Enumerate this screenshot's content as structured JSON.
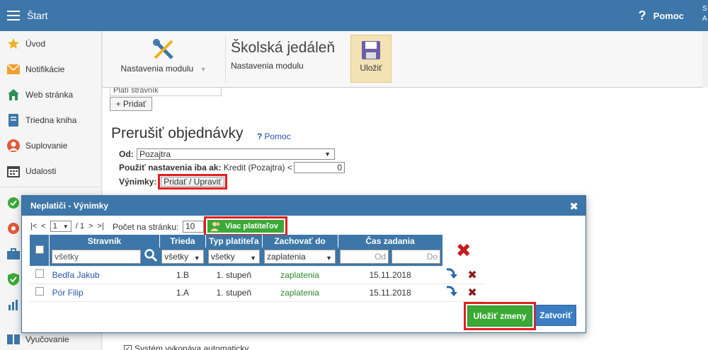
{
  "topbar": {
    "title": "Štart",
    "help_label": "Pomoc",
    "user_initial": "S",
    "user_initial2": "A"
  },
  "sidebar": {
    "items": [
      {
        "label": "Úvod",
        "icon": "star-icon"
      },
      {
        "label": "Notifikácie",
        "icon": "envelope-icon"
      },
      {
        "label": "Web stránka",
        "icon": "home-icon"
      },
      {
        "label": "Triedna kniha",
        "icon": "book-icon"
      },
      {
        "label": "Suplovanie",
        "icon": "person-icon"
      },
      {
        "label": "Udalosti",
        "icon": "calendar-icon"
      }
    ],
    "bottom_item": "Vyučovanie"
  },
  "ribbon": {
    "module_label": "Nastavenia modulu",
    "title": "Školská jedáleň",
    "subtitle": "Nastavenia modulu",
    "save_label": "Uložiť"
  },
  "main": {
    "platitel_value": "Platí stravník",
    "add_button": "+ Pridať",
    "section_title": "Prerušiť objednávky",
    "section_help": "Pomoc",
    "od_label": "Od:",
    "od_value": "Pozajtra",
    "pouzit_label": "Použiť nastavenia iba ak:",
    "pouzit_text": "Kredit (Pozajtra) <",
    "kredit_value": "0",
    "vynimky_label": "Výnimky:",
    "vynimky_button": "Pridať / Upraviť",
    "bottom_check_label": "Systém vykonáva automaticky"
  },
  "modal": {
    "title": "Neplatiči - Výnimky",
    "pager": {
      "first": "|<",
      "prev": "<",
      "page_value": "1",
      "total": "/ 1",
      "next": ">",
      "last": ">|"
    },
    "per_page_label": "Počet na stránku:",
    "per_page_value": "10",
    "more_payers_button": "Viac platiteľov",
    "columns": [
      "Stravník",
      "Trieda",
      "Typ platiteľa",
      "Zachovať do",
      "Čas zadania"
    ],
    "filters": {
      "stravnik_placeholder": "všetky",
      "trieda": "všetky",
      "typ": "všetky",
      "zachovat": "zaplatenia",
      "od_placeholder": "Od",
      "do_placeholder": "Do"
    },
    "rows": [
      {
        "name": "Bedľa Jakub",
        "trieda": "1.B",
        "typ": "1. stupeň",
        "zachovat": "zaplatenia",
        "cas": "15.11.2018"
      },
      {
        "name": "Pór Filip",
        "trieda": "1.A",
        "typ": "1. stupeň",
        "zachovat": "zaplatenia",
        "cas": "15.11.2018"
      }
    ],
    "save_button": "Uložiť zmeny",
    "close_button": "Zatvoriť"
  },
  "colors": {
    "primary": "#3d76a8",
    "green": "#3aa935",
    "highlight": "#e02020",
    "delete": "#c11d1d"
  }
}
